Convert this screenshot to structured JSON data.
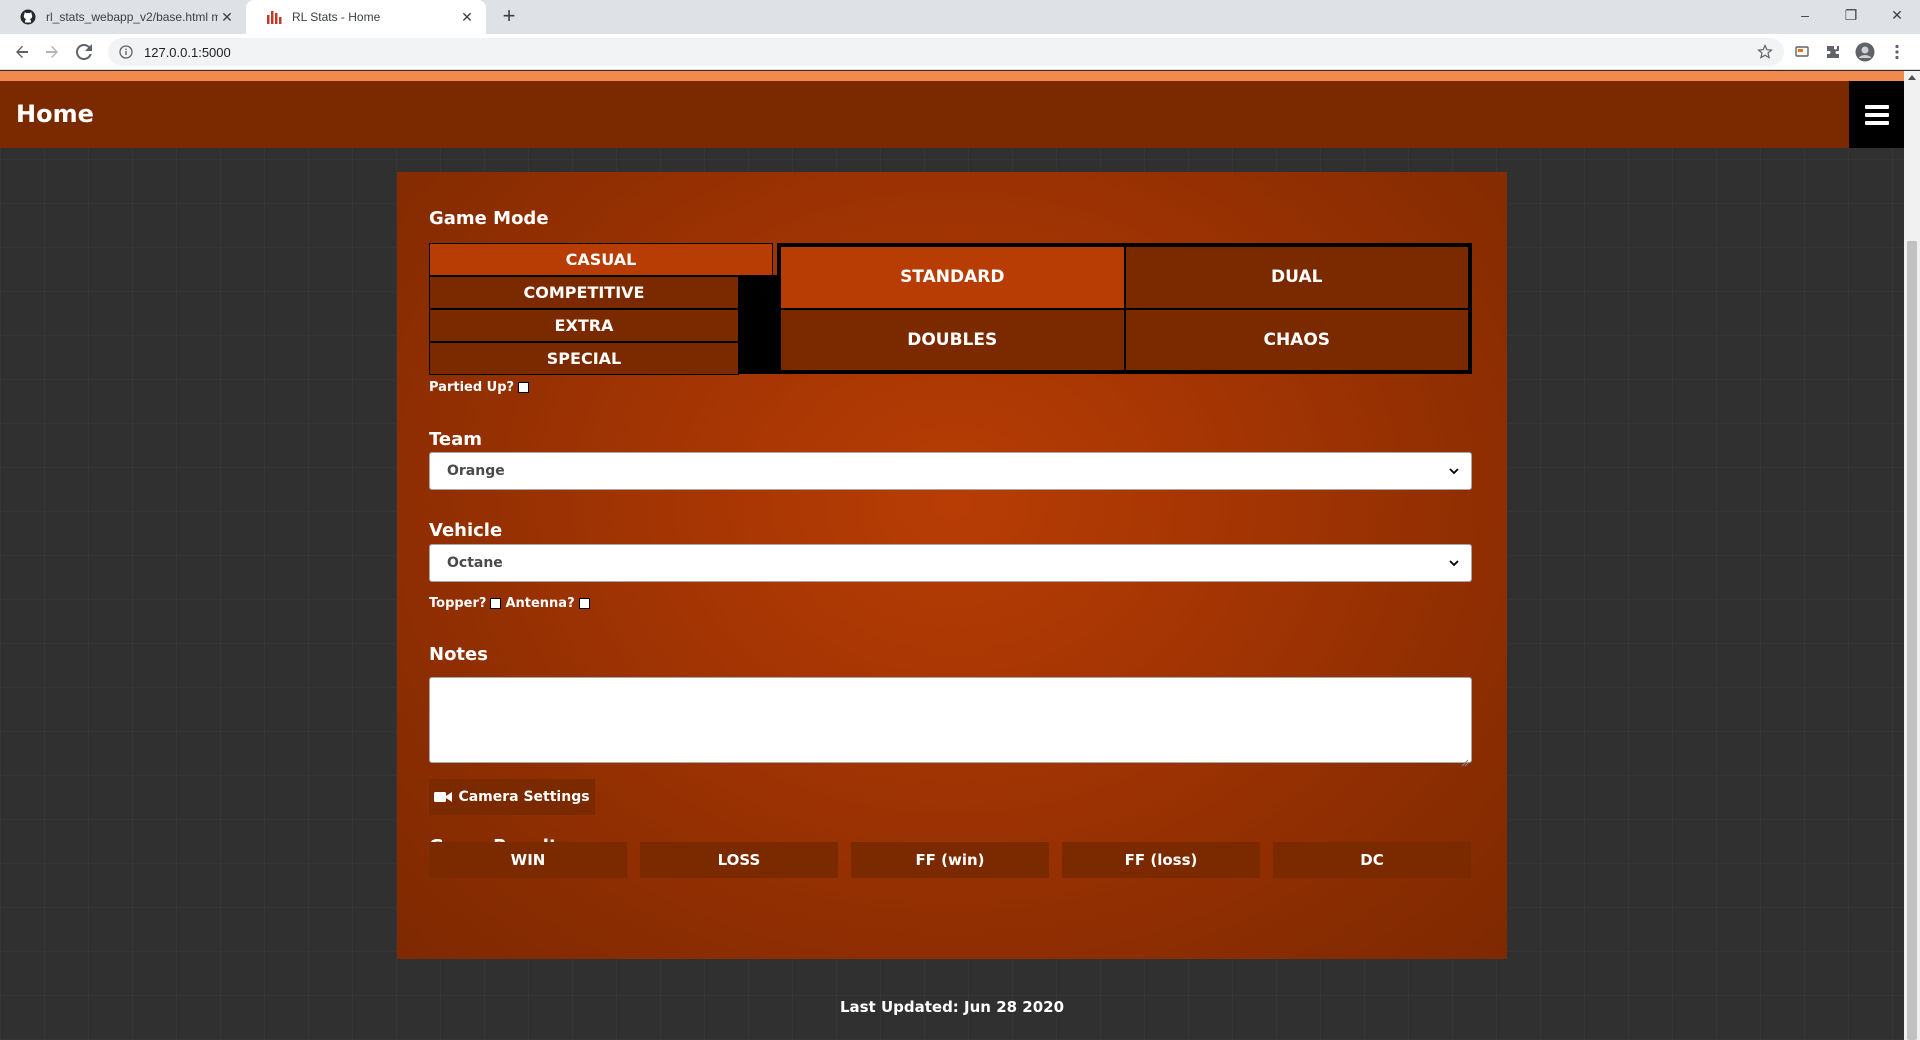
{
  "browser": {
    "tabs": [
      {
        "title": "rl_stats_webapp_v2/base.html m",
        "active": false,
        "icon": "github-icon"
      },
      {
        "title": "RL Stats - Home",
        "active": true,
        "icon": "rl-stats-icon"
      }
    ],
    "new_tab_label": "+",
    "url": "127.0.0.1:5000",
    "window_controls": {
      "minimize": "–",
      "restore": "❐",
      "close": "✕"
    },
    "tab_close": "✕"
  },
  "nav": {
    "title": "Home",
    "menu_icon": "hamburger-menu-icon"
  },
  "form": {
    "game_mode_label": "Game Mode",
    "modes": [
      {
        "label": "CASUAL",
        "active": true
      },
      {
        "label": "COMPETITIVE",
        "active": false
      },
      {
        "label": "EXTRA",
        "active": false
      },
      {
        "label": "SPECIAL",
        "active": false
      }
    ],
    "playlists": [
      {
        "label": "STANDARD",
        "active": true
      },
      {
        "label": "DUAL",
        "active": false
      },
      {
        "label": "DOUBLES",
        "active": false
      },
      {
        "label": "CHAOS",
        "active": false
      }
    ],
    "partied_up_label": "Partied Up?",
    "team_label": "Team",
    "team_value": "Orange",
    "vehicle_label": "Vehicle",
    "vehicle_value": "Octane",
    "topper_label": "Topper?",
    "antenna_label": "Antenna?",
    "notes_label": "Notes",
    "notes_value": "",
    "camera_button": "Camera Settings",
    "game_result_label": "Game Result",
    "results": [
      "WIN",
      "LOSS",
      "FF (win)",
      "FF (loss)",
      "DC"
    ]
  },
  "footer": {
    "text": "Last Updated: Jun 28 2020"
  },
  "colors": {
    "accent_strip": "#f28a4d",
    "nav_bg": "#7b2a00",
    "active_button": "#b83d05",
    "page_bg": "#303030"
  }
}
